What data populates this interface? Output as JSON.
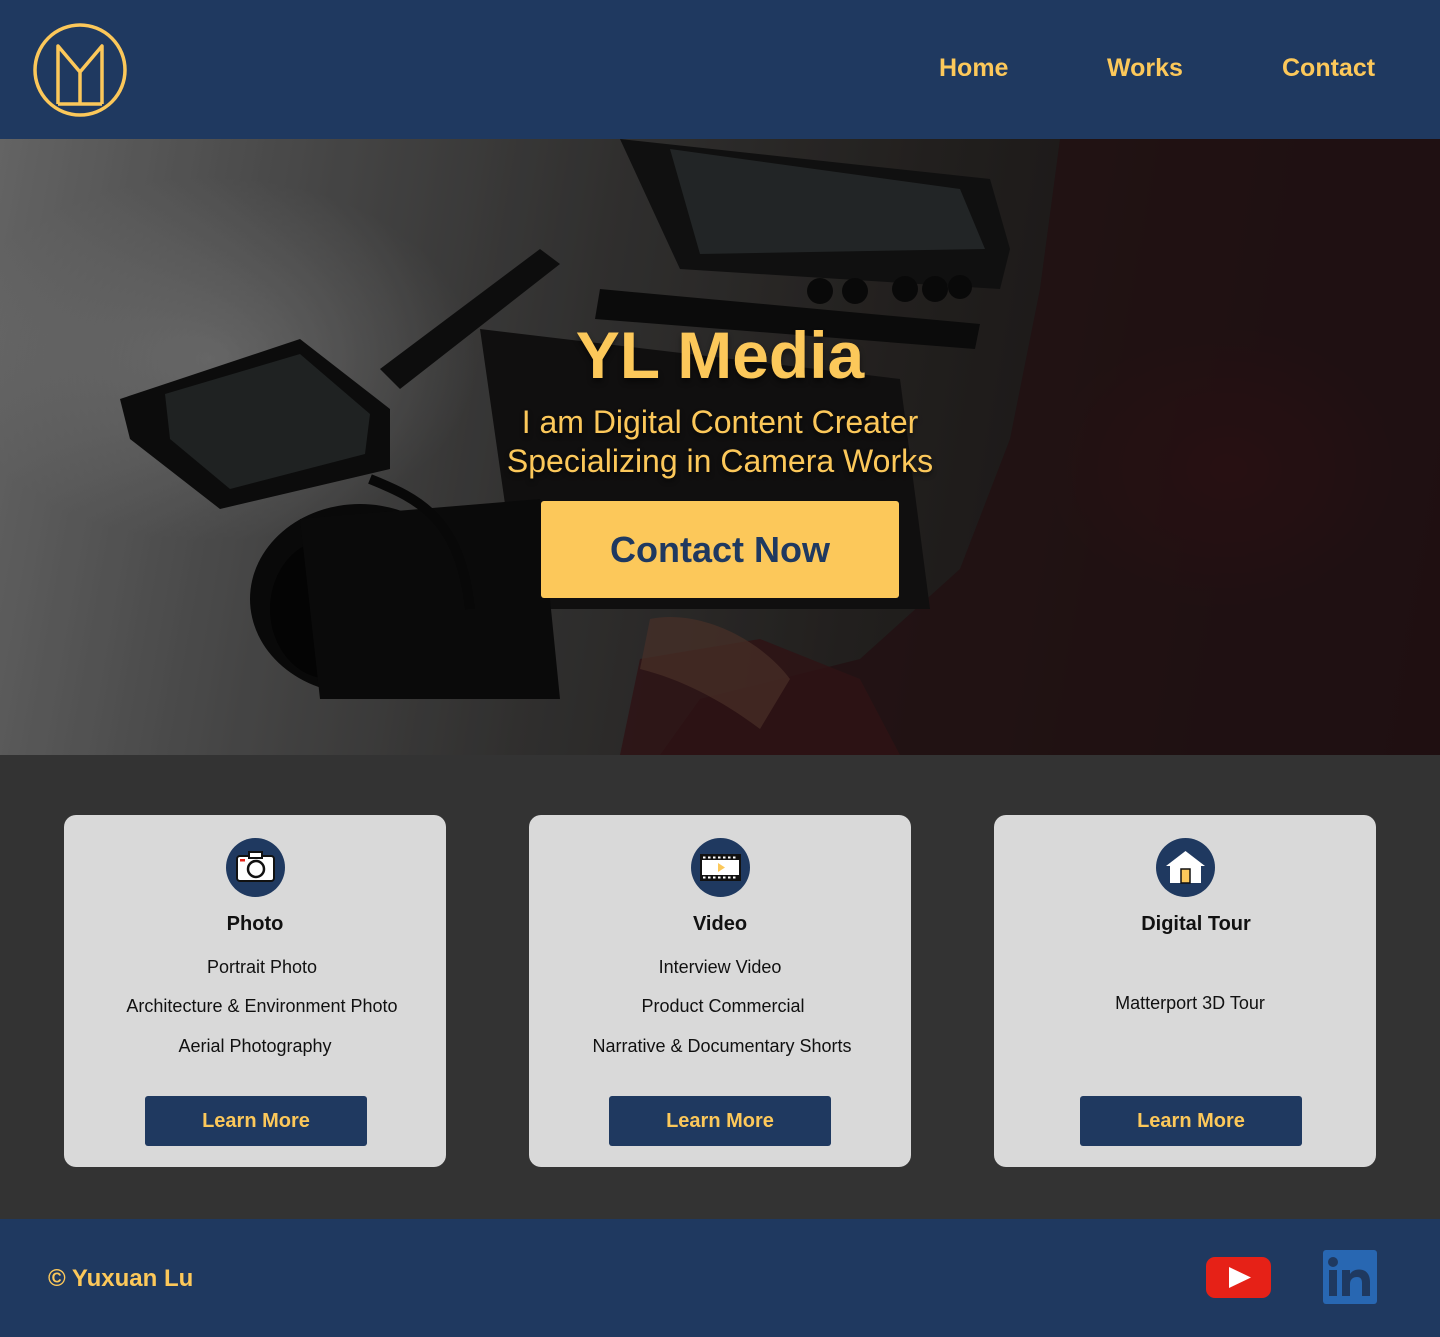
{
  "brand": {
    "logo_icon": "ym-monogram-logo",
    "accent": "#fcc85a",
    "primary": "#1f3960",
    "card_bg": "#d9d9d9",
    "section_bg": "#333333"
  },
  "nav": {
    "items": [
      {
        "label": "Home"
      },
      {
        "label": "Works"
      },
      {
        "label": "Contact"
      }
    ]
  },
  "hero": {
    "title": "YL Media",
    "subtitle_line1": "I am Digital Content Creater",
    "subtitle_line2": "Specializing in Camera Works",
    "cta_label": "Contact Now",
    "background_icon": "camera-operator-photo"
  },
  "services": [
    {
      "icon": "camera-icon",
      "title": "Photo",
      "items": [
        "Portrait Photo",
        "Architecture & Environment  Photo",
        "Aerial Photography"
      ],
      "button": "Learn More"
    },
    {
      "icon": "film-icon",
      "title": "Video",
      "items": [
        "Interview Video",
        "Product Commercial",
        "Narrative & Documentary Shorts"
      ],
      "button": "Learn More"
    },
    {
      "icon": "house-icon",
      "title": "Digital Tour",
      "items": [
        "Matterport 3D Tour"
      ],
      "button": "Learn More"
    }
  ],
  "footer": {
    "copyright": "© Yuxuan Lu",
    "social": [
      {
        "icon": "youtube-icon",
        "color": "#e62117"
      },
      {
        "icon": "linkedin-icon",
        "color": "#2867b2"
      }
    ]
  }
}
